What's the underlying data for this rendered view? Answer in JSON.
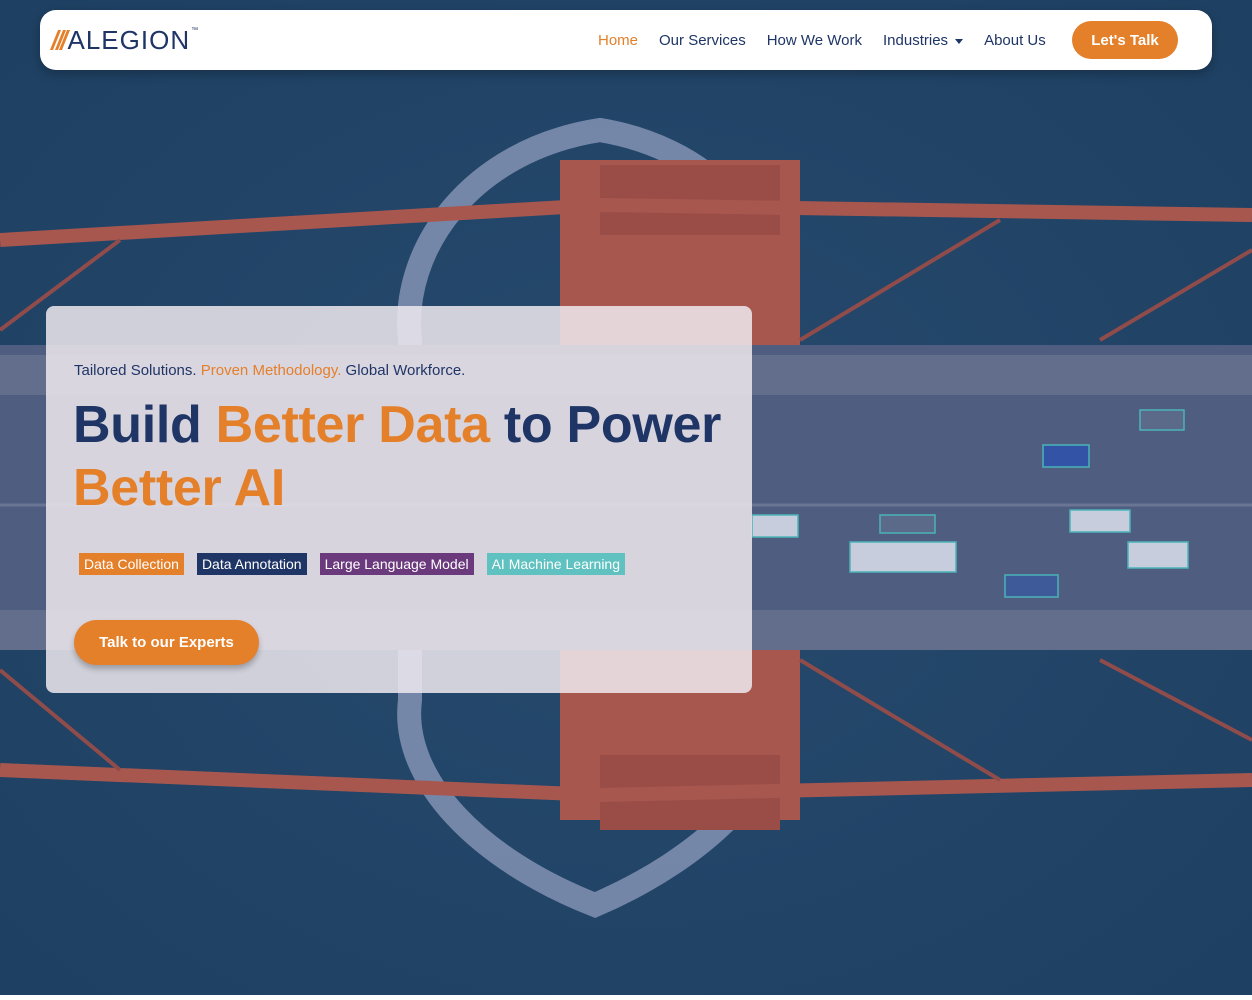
{
  "brand": {
    "logo_text": "ALEGION",
    "logo_tm": "™",
    "colors": {
      "orange": "#e47f2a",
      "navy": "#1e3566",
      "purple": "#6b3a7d",
      "teal": "#5fc2c0"
    }
  },
  "nav": {
    "items": [
      {
        "label": "Home",
        "active": true
      },
      {
        "label": "Our Services",
        "active": false
      },
      {
        "label": "How We Work",
        "active": false
      },
      {
        "label": "Industries",
        "active": false,
        "has_dropdown": true
      },
      {
        "label": "About Us",
        "active": false
      }
    ],
    "cta_label": "Let's Talk"
  },
  "hero": {
    "tagline": {
      "part1": "Tailored Solutions. ",
      "part2": "Proven Methodology.",
      "part3": " Global Workforce."
    },
    "headline": {
      "part1": "Build ",
      "part2": "Better Data",
      "part3": " to Power ",
      "part4": "Better AI"
    },
    "tags": [
      {
        "label": "Data Collection",
        "color": "#e47f2a"
      },
      {
        "label": "Data Annotation",
        "color": "#1e3566"
      },
      {
        "label": "Large Language Model",
        "color": "#6b3a7d"
      },
      {
        "label": "AI Machine Learning",
        "color": "#5fc2c0"
      }
    ],
    "cta_label": "Talk to our Experts",
    "background_image": "aerial-bridge-with-annotated-vehicles"
  }
}
